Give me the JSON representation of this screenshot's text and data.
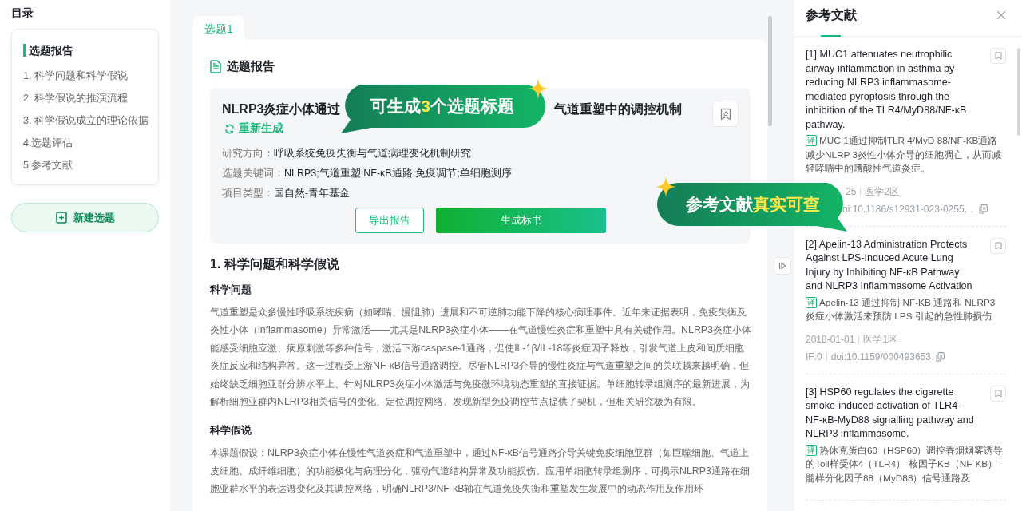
{
  "sidebar": {
    "heading": "目录",
    "toc": [
      {
        "label": "选题报告",
        "selected": true
      },
      {
        "label": "1. 科学问题和科学假说",
        "selected": false
      },
      {
        "label": "2. 科学假说的推演流程",
        "selected": false
      },
      {
        "label": "3. 科学假说成立的理论依据",
        "selected": false
      },
      {
        "label": "4.选题评估",
        "selected": false
      },
      {
        "label": "5.参考文献",
        "selected": false
      }
    ],
    "new_button": "新建选题"
  },
  "main": {
    "tabs": [
      {
        "label": "选题1",
        "selected": true
      }
    ],
    "report_heading": "选题报告",
    "topic": {
      "title_parts": [
        "NLRP3炎症小体通过",
        "气道重塑中的调控机制"
      ],
      "regenerate": "重新生成",
      "fields": [
        {
          "label": "研究方向：",
          "value": "呼吸系统免疫失衡与气道病理变化机制研究"
        },
        {
          "label": "选题关键词：",
          "value": "NLRP3;气道重塑;NF-κB通路;免疫调节;单细胞测序"
        },
        {
          "label": "项目类型：",
          "value": "国自然-青年基金"
        }
      ],
      "buttons": [
        {
          "label": "导出报告",
          "kind": "outline"
        },
        {
          "label": "生成标书",
          "kind": "primary"
        }
      ]
    },
    "section_title": "1. 科学问题和科学假说",
    "subsections": [
      {
        "heading": "科学问题",
        "text": "气道重塑是众多慢性呼吸系统疾病（如哮喘、慢阻肺）进展和不可逆肺功能下降的核心病理事件。近年来证据表明，免疫失衡及炎性小体（inflammasome）异常激活——尤其是NLRP3炎症小体——在气道慢性炎症和重塑中具有关键作用。NLRP3炎症小体能感受细胞应激、病原刺激等多种信号，激活下游caspase-1通路，促使IL-1β/IL-18等炎症因子释放，引发气道上皮和间质细胞炎症反应和结构异常。这一过程受上游NF-κB信号通路调控。尽管NLRP3介导的慢性炎症与气道重塑之间的关联越来越明确，但始终缺乏细胞亚群分辨水平上、针对NLRP3炎症小体激活与免疫微环境动态重塑的直接证据。单细胞转录组测序的最新进展，为解析细胞亚群内NLRP3相关信号的变化、定位调控网络、发现新型免疫调控节点提供了契机，但相关研究极为有限。"
      },
      {
        "heading": "科学假说",
        "text": "本课题假设：NLRP3炎症小体在慢性气道炎症和气道重塑中，通过NF-κB信号通路介导关键免疫细胞亚群（如巨噬细胞、气道上皮细胞、成纤维细胞）的功能极化与病理分化，驱动气道结构异常及功能损伤。应用单细胞转录组测序，可揭示NLRP3通路在细胞亚群水平的表达谱变化及其调控网络，明确NLRP3/NF-κB轴在气道免疫失衡和重塑发生发展中的动态作用及作用环"
      }
    ]
  },
  "references": {
    "title": "参考文献",
    "items": [
      {
        "title": "[1] MUC1 attenuates neutrophilic airway inflammation in asthma by reducing NLRP3 inflammasome-mediated pyroptosis through the inhibition of the TLR4/MyD88/NF-κB pathway.",
        "badge": "译",
        "translation": "MUC 1通过抑制TLR 4/MyD 88/NF-KB通路减少NLRP 3炎性小体介导的细胞凋亡，从而减轻哮喘中的嗜酸性气道炎症。",
        "meta": [
          [
            "-25",
            "医学2区"
          ],
          [
            "oi:10.1186/s12931-023-0255…"
          ]
        ]
      },
      {
        "title": "[2] Apelin-13 Administration Protects Against LPS-Induced Acute Lung Injury by Inhibiting NF-κB Pathway and NLRP3 Inflammasome Activation",
        "badge": "译",
        "translation": "Apelin-13 通过抑制 NF-KB 通路和 NLRP3 炎症小体激活来预防 LPS 引起的急性肺损伤",
        "meta": [
          [
            "2018-01-01",
            "医学1区"
          ],
          [
            "IF:0",
            "doi:10.1159/000493653"
          ]
        ]
      },
      {
        "title": "[3] HSP60 regulates the cigarette smoke-induced activation of TLR4-NF-κB-MyD88 signalling pathway and NLRP3 inflammasome.",
        "badge": "译",
        "translation": "热休克蛋白60（HSP60）调控香烟烟雾诱导的Toll样受体4（TLR4）-核因子KB（NF-KB）-髓样分化因子88（MyD88）信号通路及"
      }
    ]
  },
  "callouts": [
    {
      "text": "可生成**3**个选题标题",
      "kind": "left-tail"
    },
    {
      "text": "参考文献**真实可查**",
      "kind": "right-tail"
    }
  ]
}
